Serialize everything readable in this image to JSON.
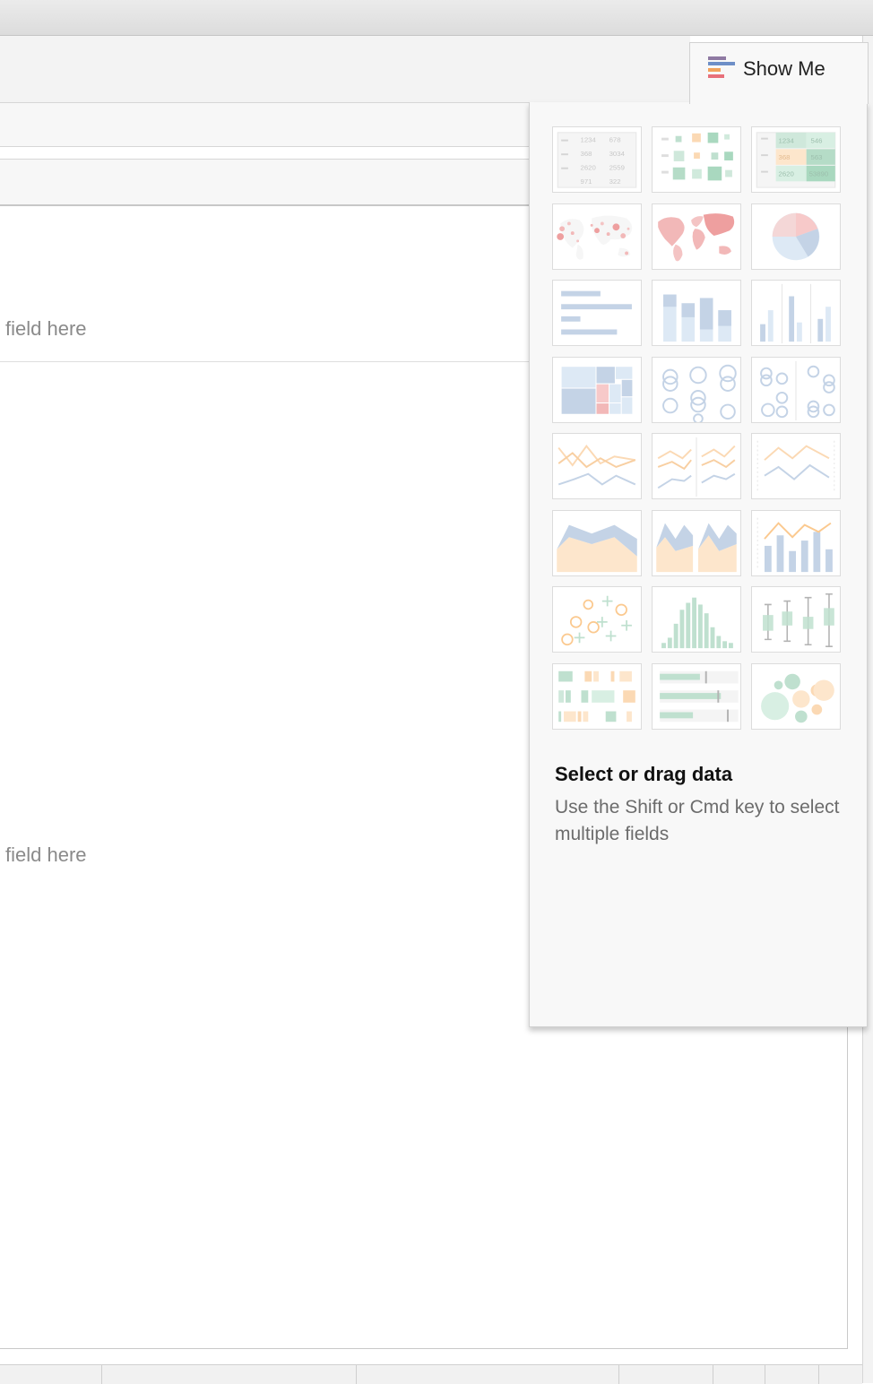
{
  "showme": {
    "tab_label": "Show Me",
    "tab_icon": "show-me-bars-icon",
    "chart_types": [
      {
        "name": "text-table",
        "icon": "text-table-icon"
      },
      {
        "name": "heat-map",
        "icon": "heat-map-icon"
      },
      {
        "name": "highlight-table",
        "icon": "highlight-table-icon"
      },
      {
        "name": "symbol-map",
        "icon": "symbol-map-icon"
      },
      {
        "name": "filled-map",
        "icon": "filled-map-icon"
      },
      {
        "name": "pie-chart",
        "icon": "pie-chart-icon"
      },
      {
        "name": "horizontal-bars",
        "icon": "horizontal-bars-icon"
      },
      {
        "name": "stacked-bars",
        "icon": "stacked-bars-icon"
      },
      {
        "name": "side-by-side-bars",
        "icon": "side-by-side-bars-icon"
      },
      {
        "name": "treemap",
        "icon": "treemap-icon"
      },
      {
        "name": "circle-views",
        "icon": "circle-views-icon"
      },
      {
        "name": "side-by-side-circles",
        "icon": "side-by-side-circles-icon"
      },
      {
        "name": "lines-continuous",
        "icon": "lines-continuous-icon"
      },
      {
        "name": "lines-discrete",
        "icon": "lines-discrete-icon"
      },
      {
        "name": "dual-lines",
        "icon": "dual-lines-icon"
      },
      {
        "name": "area-charts-continuous",
        "icon": "area-continuous-icon"
      },
      {
        "name": "area-charts-discrete",
        "icon": "area-discrete-icon"
      },
      {
        "name": "dual-combination",
        "icon": "dual-combination-icon"
      },
      {
        "name": "scatter-plots",
        "icon": "scatter-plots-icon"
      },
      {
        "name": "histogram",
        "icon": "histogram-icon"
      },
      {
        "name": "box-and-whisker",
        "icon": "box-whisker-icon"
      },
      {
        "name": "gantt-chart",
        "icon": "gantt-chart-icon"
      },
      {
        "name": "bullet-graphs",
        "icon": "bullet-graphs-icon"
      },
      {
        "name": "packed-bubbles",
        "icon": "packed-bubbles-icon"
      }
    ],
    "text_table_numbers": [
      "1234",
      "678",
      "368",
      "3034",
      "2620",
      "2559",
      "971",
      "322"
    ],
    "highlight_table_numbers": [
      "1234",
      "546",
      "368",
      "563",
      "2620",
      "53890"
    ],
    "hint_title": "Select or drag data",
    "hint_body": "Use the Shift or Cmd key to select multiple fields"
  },
  "canvas": {
    "drop_text_top": "field here",
    "drop_text_bottom": "field here"
  },
  "colors": {
    "blue": "#c4d3e6",
    "orange": "#fbd9b4",
    "green": "#bfe0cf",
    "red": "#f2b8b8",
    "gray": "#d8d8d8",
    "tab_icon_purple": "#8f7aa3",
    "tab_icon_blue": "#6e8fc7",
    "tab_icon_orange": "#f2a35c",
    "tab_icon_red": "#e8707a"
  }
}
